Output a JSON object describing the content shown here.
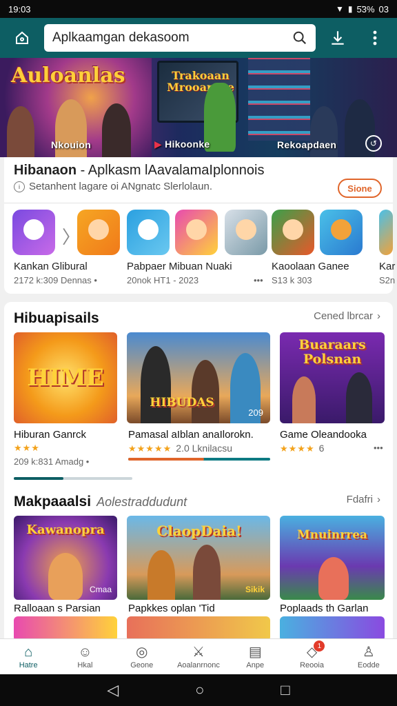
{
  "status": {
    "time": "19:03",
    "battery": "5̈3%",
    "extra": "03"
  },
  "app_bar": {
    "search_text": "Aplkaamgan dekasoom"
  },
  "hero": {
    "title": "Auloanlas",
    "screen_title": "Trakoaan Mrooarnce",
    "labels": [
      "Nkouion",
      "Hikoonke",
      "Rekoapdaen"
    ]
  },
  "card1": {
    "title_bold": "Hibanaon",
    "title_rest": " - Aplkasm lAavalamaIplonnois",
    "subtitle": "Setanhent lagare oi ANgnatc Slerlolaun.",
    "button": "Sione",
    "apps": [
      {
        "name": "Kankan Glibural",
        "meta": "2172 k:309   Dennas •"
      },
      {
        "name": "Pabpaer Mibuan Nuaki",
        "meta": "20nok HT1 - 2023"
      },
      {
        "name": "",
        "meta": "•••"
      },
      {
        "name": "Kaoolaan Ganee",
        "meta": "S13 k 303"
      },
      {
        "name": "Kar",
        "meta": "S2n"
      }
    ]
  },
  "section_games": {
    "title": "Hibuapisails",
    "link": "Cened lbrcar",
    "items": [
      {
        "name": "Hiburan Ganrck",
        "tile_text": "HIME",
        "stars": "★★★",
        "meta": "209 k:831   Amadg •"
      },
      {
        "name": "Pamasal aIblan anaIlorokn.",
        "tile_text": "HIBUDAS",
        "stars": "★★★★★",
        "rating": "2.0 Lknilacsu",
        "badge": "209"
      },
      {
        "name": "Game Oleandooka",
        "tile_text": "Buaraars Polsnan",
        "stars": "★★★★",
        "rating": "6",
        "meta": "•••"
      }
    ]
  },
  "section_popular": {
    "title": "Makpaaalsi",
    "subtitle": "Aolestraddudunt",
    "link": "Fdafri",
    "items": [
      {
        "name": "Ralloaan s Parsian",
        "tile_text": "Kawanopra",
        "badge": "Cmaa"
      },
      {
        "name": "Papkkes oplan 'Tid",
        "tile_text": "ClaopDaia!",
        "badge": "Sikik"
      },
      {
        "name": "Poplaads th Garlan",
        "tile_text": "Mnuinrrea"
      }
    ]
  },
  "bottom_nav": [
    {
      "label": "Hatre",
      "icon": "home-icon"
    },
    {
      "label": "Hkal",
      "icon": "smiley-icon"
    },
    {
      "label": "Geone",
      "icon": "controller-icon"
    },
    {
      "label": "Aoalanrnonc",
      "icon": "swords-icon"
    },
    {
      "label": "Anpe",
      "icon": "document-icon"
    },
    {
      "label": "Reooia",
      "icon": "chat-icon",
      "badge": "1"
    },
    {
      "label": "Eodde",
      "icon": "person-icon"
    }
  ],
  "colors": {
    "accent": "#0d5e63",
    "orange": "#e0652a",
    "star": "#f3a21b"
  }
}
